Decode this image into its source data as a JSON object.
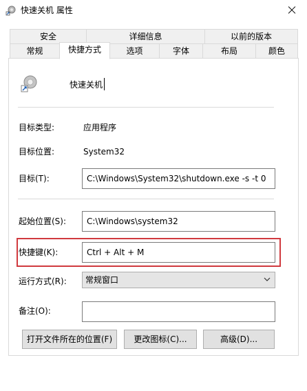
{
  "window": {
    "title": "快速关机 属性"
  },
  "tabs_row1": [
    "安全",
    "详细信息",
    "以前的版本"
  ],
  "tabs_row2": [
    "常规",
    "快捷方式",
    "选项",
    "字体",
    "布局",
    "颜色"
  ],
  "active_tab": "快捷方式",
  "shortcut": {
    "name": "快速关机",
    "icon": "shortcut-app-icon"
  },
  "info": {
    "target_type_label": "目标类型:",
    "target_type_value": "应用程序",
    "target_location_label": "目标位置:",
    "target_location_value": "System32",
    "target_label": "目标(T):",
    "target_value": "C:\\Windows\\System32\\shutdown.exe -s -t 0"
  },
  "fields": {
    "start_in_label": "起始位置(S):",
    "start_in_value": "C:\\Windows\\system32",
    "hotkey_label": "快捷键(K):",
    "hotkey_value": "Ctrl + Alt + M",
    "run_label": "运行方式(R):",
    "run_value": "常规窗口",
    "comment_label": "备注(O):",
    "comment_value": ""
  },
  "buttons": {
    "open_location": "打开文件所在的位置(F)",
    "change_icon": "更改图标(C)...",
    "advanced": "高级(D)..."
  },
  "colors": {
    "highlight": "#d0393e",
    "tab_inactive": "#f0f0f0",
    "button_face": "#e1e1e1"
  }
}
